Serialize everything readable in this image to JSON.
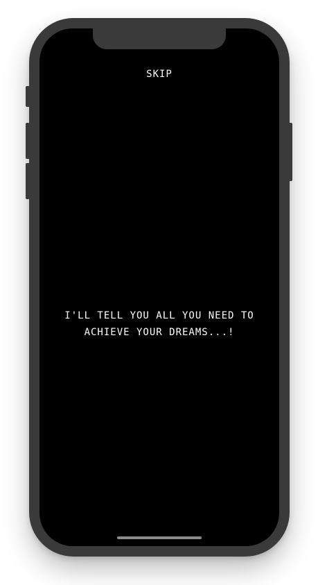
{
  "screen": {
    "skip_label": "SKIP",
    "message_line1": "I'LL TELL YOU ALL YOU NEED TO",
    "message_line2": "ACHIEVE YOUR DREAMS...!"
  },
  "colors": {
    "screen_background": "#000000",
    "text": "#ffffff",
    "device_frame": "#3a3a3a",
    "home_indicator": "#8a8a8a"
  }
}
